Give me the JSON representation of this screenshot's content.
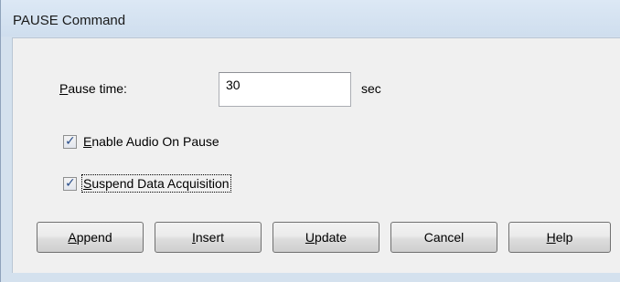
{
  "window": {
    "title": "PAUSE Command"
  },
  "pause_time": {
    "label_accel": "P",
    "label_rest": "ause time:",
    "value": "30",
    "unit": "sec"
  },
  "checkboxes": [
    {
      "label_accel": "E",
      "label_rest": "nable Audio On Pause",
      "checked": true
    },
    {
      "label_accel": "S",
      "label_rest": "uspend Data Acquisition",
      "checked": true
    }
  ],
  "buttons": [
    {
      "accel": "A",
      "rest": "ppend"
    },
    {
      "accel": "I",
      "rest": "nsert"
    },
    {
      "accel": "U",
      "rest": "pdate"
    },
    {
      "accel": "",
      "rest": "Cancel"
    },
    {
      "accel": "H",
      "rest": "elp"
    }
  ]
}
